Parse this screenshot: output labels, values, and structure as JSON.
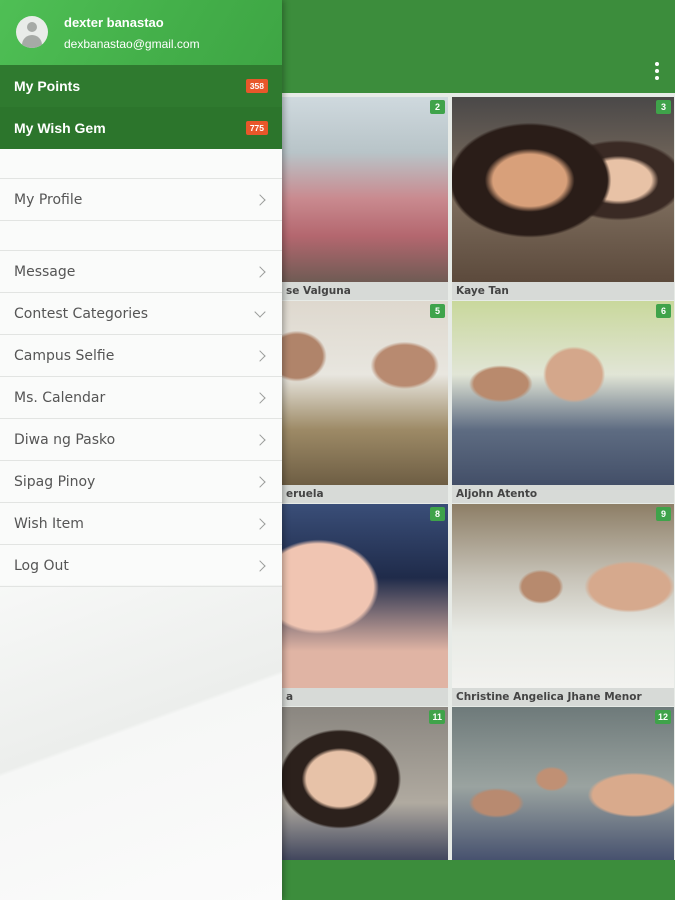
{
  "drawer": {
    "user": {
      "name": "dexter banastao",
      "email": "dexbanastao@gmail.com"
    },
    "stats": [
      {
        "label": "My Points",
        "badge": "358"
      },
      {
        "label": "My Wish Gem",
        "badge": "775"
      }
    ],
    "profile_item": {
      "label": "My Profile",
      "icon": "chevron-right-icon"
    },
    "menu": [
      {
        "label": "Message",
        "icon": "chevron-right-icon"
      },
      {
        "label": "Contest Categories",
        "icon": "chevron-down-icon"
      },
      {
        "label": "Campus Selfie",
        "icon": "chevron-right-icon"
      },
      {
        "label": "Ms. Calendar",
        "icon": "chevron-right-icon"
      },
      {
        "label": "Diwa ng Pasko",
        "icon": "chevron-right-icon"
      },
      {
        "label": "Sipag Pinoy",
        "icon": "chevron-right-icon"
      },
      {
        "label": "Wish Item",
        "icon": "chevron-right-icon"
      },
      {
        "label": "Log Out",
        "icon": "chevron-right-icon"
      }
    ]
  },
  "app_bar": {
    "overflow_icon": "more-vert-icon"
  },
  "gallery": [
    {
      "number": "2",
      "caption": "se Valguna"
    },
    {
      "number": "3",
      "caption": "Kaye Tan"
    },
    {
      "number": "5",
      "caption": "eruela"
    },
    {
      "number": "6",
      "caption": "Aljohn Atento"
    },
    {
      "number": "8",
      "caption": "a"
    },
    {
      "number": "9",
      "caption": "Christine Angelica Jhane Menor"
    },
    {
      "number": "11",
      "caption": ""
    },
    {
      "number": "12",
      "caption": ""
    }
  ],
  "colors": {
    "primary": "#3c8d3c",
    "header_green": "#4fbf55",
    "dark_green": "#2f7a2f",
    "badge_orange": "#e8572a",
    "number_green": "#3fa34a"
  }
}
